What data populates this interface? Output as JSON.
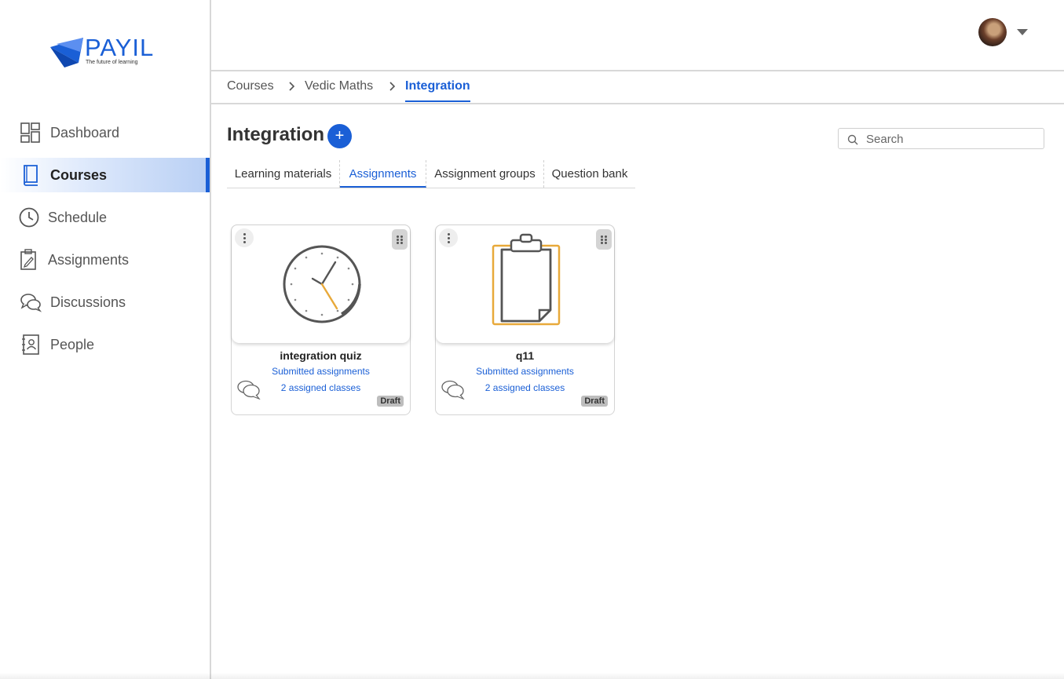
{
  "brand": {
    "logo_text": "PAYIL",
    "tagline": "The future of learning",
    "accent_color": "#1a5fd6"
  },
  "sidebar": {
    "items": [
      {
        "label": "Dashboard",
        "icon": "dashboard-grid-icon",
        "active": false
      },
      {
        "label": "Courses",
        "icon": "book-icon",
        "active": true
      },
      {
        "label": "Schedule",
        "icon": "clock-icon",
        "active": false
      },
      {
        "label": "Assignments",
        "icon": "clipboard-pencil-icon",
        "active": false
      },
      {
        "label": "Discussions",
        "icon": "chat-bubbles-icon",
        "active": false
      },
      {
        "label": "People",
        "icon": "contact-book-icon",
        "active": false
      }
    ]
  },
  "header": {
    "avatar": "user-avatar",
    "menu_icon": "caret-down-icon"
  },
  "breadcrumb": {
    "items": [
      "Courses",
      "Vedic Maths",
      "Integration"
    ],
    "separator_icon": "chevron-right-icon"
  },
  "main": {
    "title": "Integration",
    "add_label": "+",
    "search": {
      "placeholder": "Search",
      "value": ""
    },
    "tabs": [
      {
        "label": "Learning materials",
        "active": false
      },
      {
        "label": "Assignments",
        "active": true
      },
      {
        "label": "Assignment groups",
        "active": false
      },
      {
        "label": "Question bank",
        "active": false
      }
    ],
    "cards": [
      {
        "title": "integration quiz",
        "link1": "Submitted assignments",
        "link2": "2 assigned classes",
        "status": "Draft",
        "art_icon": "clock-illustration-icon"
      },
      {
        "title": "q11",
        "link1": "Submitted assignments",
        "link2": "2 assigned classes",
        "status": "Draft",
        "art_icon": "clipboard-illustration-icon"
      }
    ]
  }
}
